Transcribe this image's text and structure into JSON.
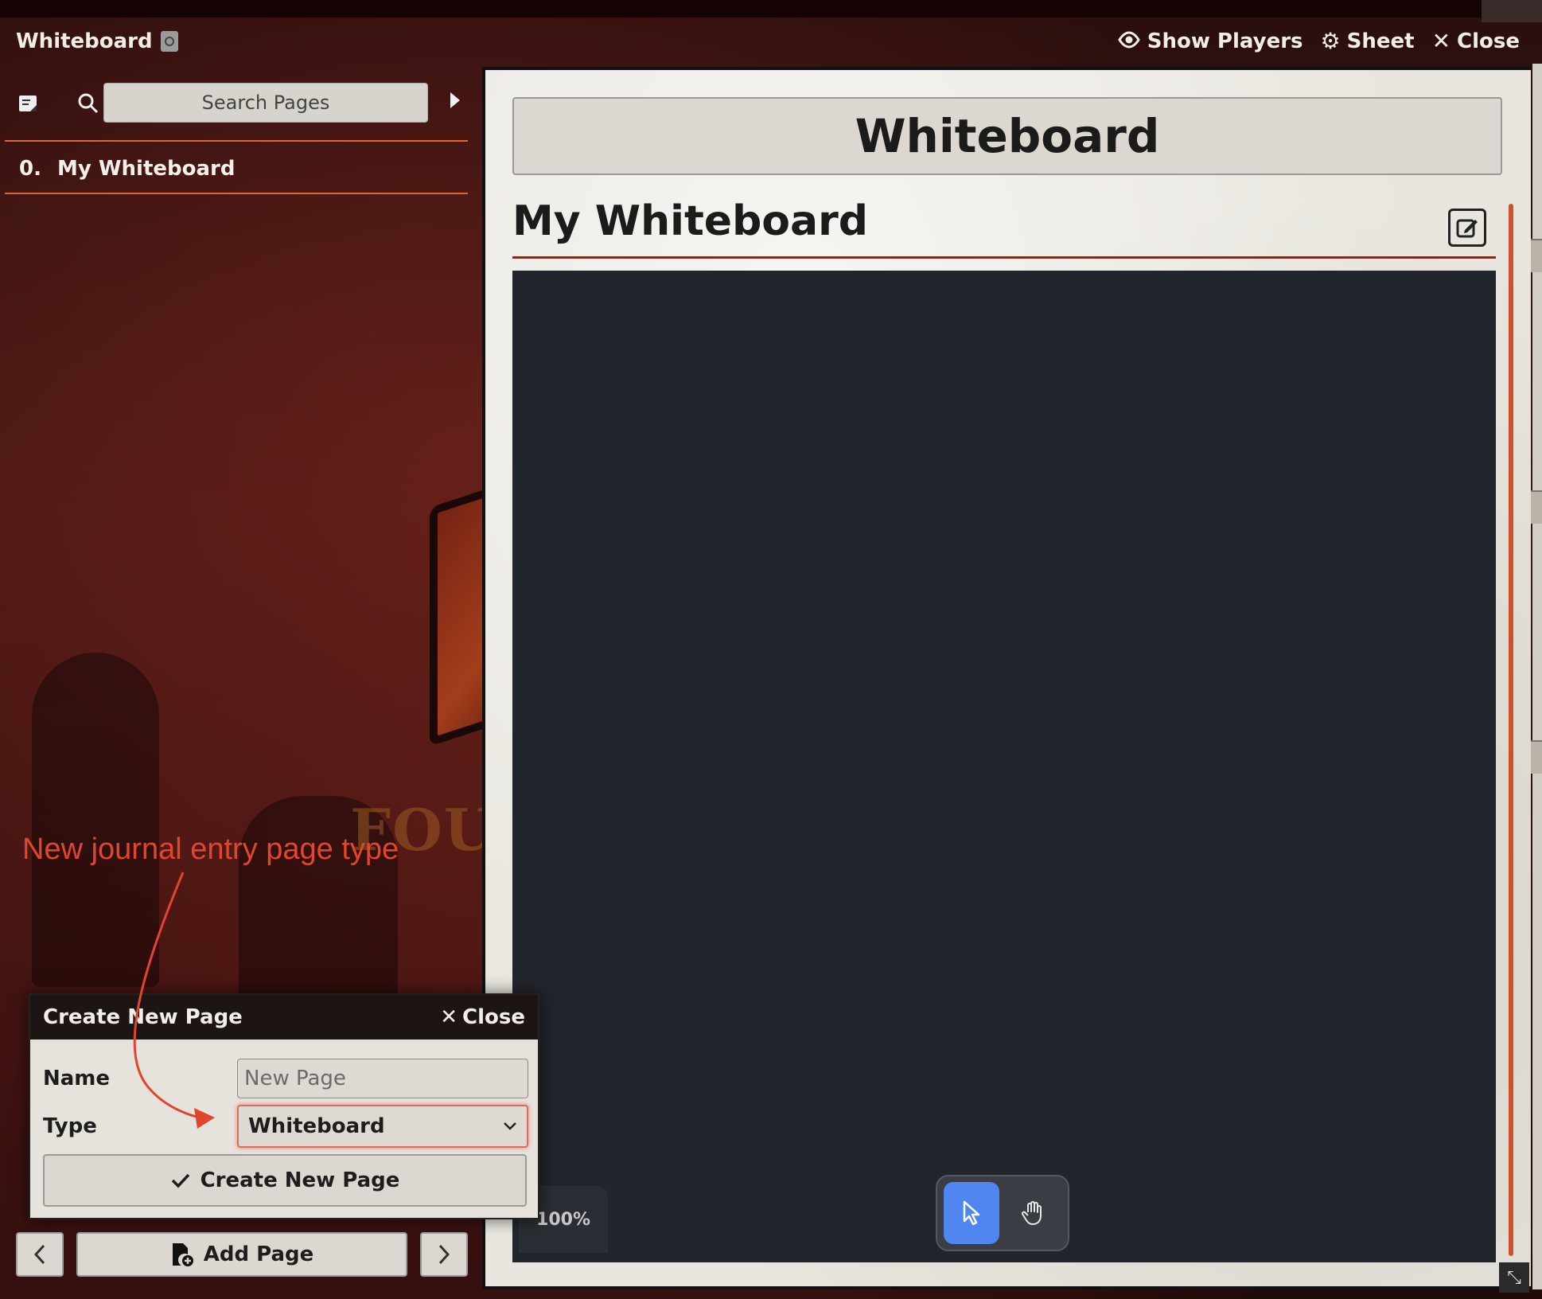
{
  "window": {
    "title": "Whiteboard",
    "actions": {
      "show_players": "Show Players",
      "sheet": "Sheet",
      "close": "Close"
    }
  },
  "sidebar": {
    "search": {
      "placeholder": "Search Pages"
    },
    "pages": [
      {
        "number": "0.",
        "label": "My Whiteboard"
      }
    ]
  },
  "main": {
    "title": "Whiteboard",
    "page_heading": "My Whiteboard",
    "zoom": "100%",
    "tools": [
      "select-pointer",
      "pan-hand"
    ]
  },
  "dialog": {
    "title": "Create New Page",
    "close": "Close",
    "name_label": "Name",
    "name_placeholder": "New Page",
    "type_label": "Type",
    "type_value": "Whiteboard",
    "submit": "Create New Page"
  },
  "footer": {
    "add_page": "Add Page"
  },
  "annotation": {
    "text": "New journal entry page type"
  },
  "colors": {
    "accent_orange": "#e0672c",
    "annotation_red": "#e2452e",
    "active_tool": "#4f86f0",
    "canvas": "#22252b"
  }
}
